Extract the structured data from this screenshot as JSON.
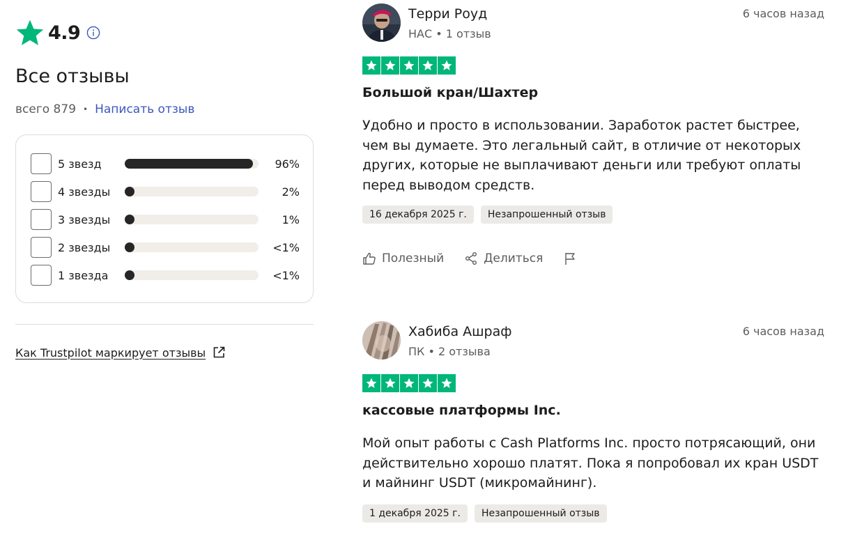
{
  "summary": {
    "score": "4.9",
    "title": "Все отзывы",
    "total": "всего 879",
    "separator": "•",
    "write_review": "Написать отзыв",
    "star_color": "#00b67a",
    "distribution": [
      {
        "label": "5 звезд",
        "percent_text": "96%",
        "fraction": 0.96
      },
      {
        "label": "4 звезды",
        "percent_text": "2%",
        "fraction": 0.02
      },
      {
        "label": "3 звезды",
        "percent_text": "1%",
        "fraction": 0.01
      },
      {
        "label": "2 звезды",
        "percent_text": "<1%",
        "fraction": 0.005
      },
      {
        "label": "1 звезда",
        "percent_text": "<1%",
        "fraction": 0.005
      }
    ],
    "how_link": "Как Trustpilot маркирует отзывы"
  },
  "reviews": [
    {
      "name": "Терри Роуд",
      "meta": "НАС • 1 отзыв",
      "time": "6 часов назад",
      "rating": 5,
      "title": "Большой кран/Шахтер",
      "body": "Удобно и просто в использовании. Заработок растет быстрее, чем вы думаете. Это легальный сайт, в отличие от некоторых других, которые не выплачивают деньги или требуют оплаты перед выводом средств.",
      "date": "16 декабря 2025 г.",
      "badge": "Незапрошенный отзыв",
      "useful_label": "Полезный",
      "share_label": "Делиться"
    },
    {
      "name": "Хабиба Ашраф",
      "meta": "ПК • 2 отзыва",
      "time": "6 часов назад",
      "rating": 5,
      "title": "кассовые платформы Inc.",
      "body": "Мой опыт работы с Cash Platforms Inc. просто потрясающий, они действительно хорошо платят. Пока я попробовал их кран USDT и майнинг USDT (микромайнинг).",
      "date": "1 декабря 2025 г.",
      "badge": "Незапрошенный отзыв"
    }
  ]
}
